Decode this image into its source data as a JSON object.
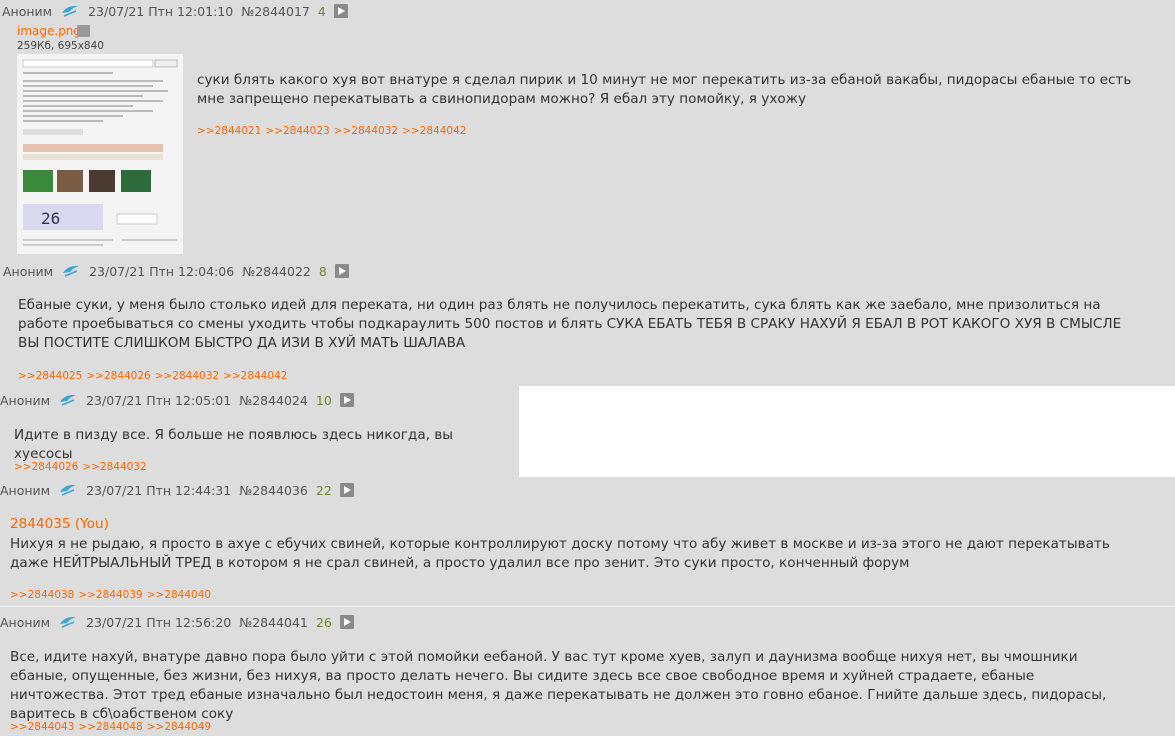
{
  "posts": [
    {
      "name": "Аноним",
      "date": "23/07/21 Птн 12:01:10",
      "num": "№2844017",
      "count": "4",
      "file": {
        "name": "image.png",
        "meta": "259Кб, 695x840"
      },
      "text": "суки блять какого хуя вот внатуре я сделал пирик и 10 минут не мог перекатить из-за ебаной вакабы, пидорасы ебаные то есть мне запрещено перекатывать а свинопидорам можно? Я ебал эту помойку, я ухожу",
      "replies": [
        ">>2844021",
        ">>2844023",
        ">>2844032",
        ">>2844042"
      ]
    },
    {
      "name": "Аноним",
      "date": "23/07/21 Птн 12:04:06",
      "num": "№2844022",
      "count": "8",
      "text": "Ебаные суки, у меня было столько идей для переката, ни один раз блять не получилось перекатить, сука блять как же заебало, мне призолиться на работе проебываться со смены уходить чтобы подкараулить 500 постов и блять СУКА ЕБАТЬ ТЕБЯ В СРАКУ НАХУЙ Я ЕБАЛ В РОТ КАКОГО ХУЯ В СМЫСЛЕ ВЫ ПОСТИТЕ СЛИШКОМ БЫСТРО ДА ИЗИ В ХУЙ МАТЬ ШАЛАВА",
      "replies": [
        ">>2844025",
        ">>2844026",
        ">>2844032",
        ">>2844042"
      ]
    },
    {
      "name": "Аноним",
      "date": "23/07/21 Птн 12:05:01",
      "num": "№2844024",
      "count": "10",
      "text": "Идите в пизду все. Я больше не появлюсь здесь никогда, вы хуесосы",
      "replies": [
        ">>2844026",
        ">>2844032"
      ]
    },
    {
      "name": "Аноним",
      "date": "23/07/21 Птн 12:44:31",
      "num": "№2844036",
      "count": "22",
      "quote": "2844035 (You)",
      "text": "Нихуя я не рыдаю, я просто в ахуе с ебучих свиней, которые контроллируют доску потому что абу живет в москве и из-за этого не дают перекатывать даже НЕЙТРЫАЛЬНЫЙ ТРЕД в котором я не срал свиней, а просто удалил все про зенит. Это суки просто, конченный форум",
      "replies": [
        ">>2844038",
        ">>2844039",
        ">>2844040"
      ]
    },
    {
      "name": "Аноним",
      "date": "23/07/21 Птн 12:56:20",
      "num": "№2844041",
      "count": "26",
      "text": "Все, идите нахуй, внатуре давно пора было уйти с этой помойки еебаной. У вас тут кроме хуев, залуп и даунизма вообще нихуя нет, вы чмошники ебаные, опущенные, без жизни, без нихуя, ва просто делать нечего. Вы сидите здесь все свое свободное время и хуйней страдаете, ебаные ничтожества. Этот тред ебаные изначально был недостоин меня, я даже перекатывать не должен это говно ебаное. Гнийте дальше здесь, пидорасы, варитесь в сб\\оабственом соку",
      "replies": [
        ">>2844043",
        ">>2844048",
        ">>2844049"
      ]
    }
  ],
  "colors": {
    "background": "#dddddd",
    "link": "#ff6600",
    "count": "#6e8a2f"
  },
  "icons": {
    "emblem": "zenit-emblem-icon",
    "play": "play-icon",
    "search": "search-icon"
  }
}
